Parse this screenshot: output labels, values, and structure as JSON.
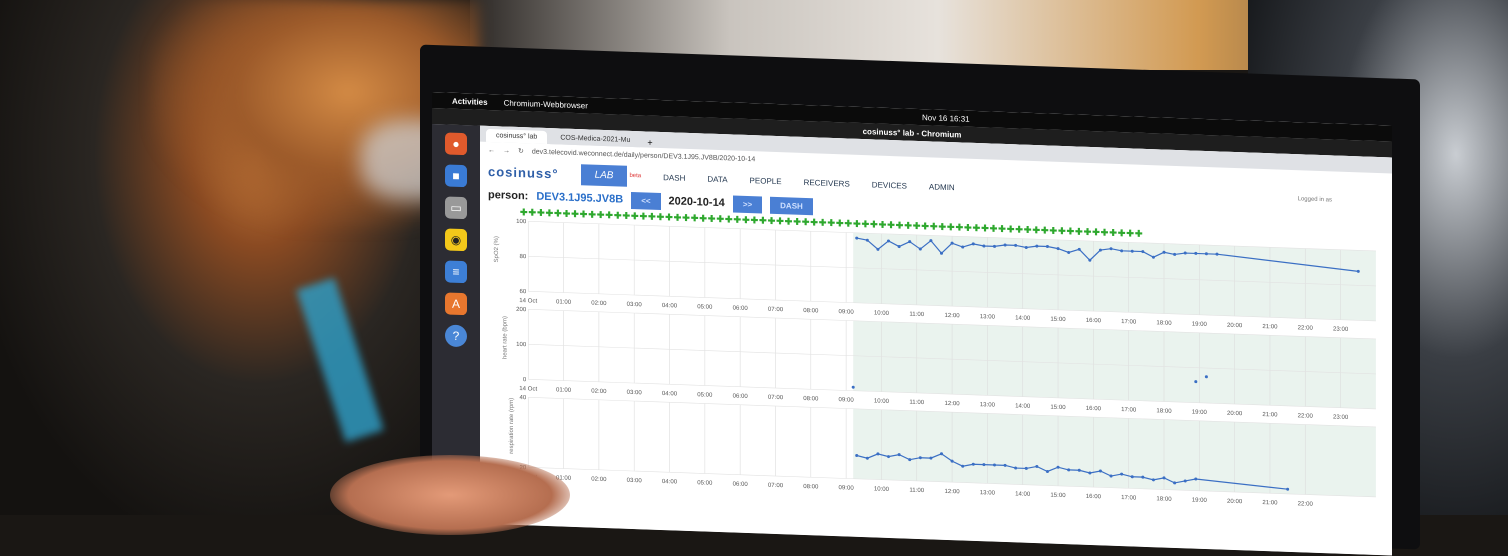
{
  "desktop": {
    "activities": "Activities",
    "app_menu": "Chromium-Webbrowser",
    "clock": "Nov 16 16:31",
    "window_title": "cosinuss° lab - Chromium"
  },
  "browser": {
    "tabs": [
      {
        "label": "cosinuss° lab"
      },
      {
        "label": "COS-Medica-2021-Mu"
      }
    ],
    "url": "dev3.telecovid.weconnect.de/daily/person/DEV3.1J95.JV8B/2020-10-14"
  },
  "app": {
    "logo": "cosinuss°",
    "lab": "LAB",
    "beta": "beta",
    "nav": [
      "DASH",
      "DATA",
      "PEOPLE",
      "RECEIVERS",
      "DEVICES",
      "ADMIN"
    ],
    "logged_in": "Logged in as",
    "person_label": "person:",
    "person_id": "DEV3.1J95.JV8B",
    "prev_button": "<<",
    "date": "2020-10-14",
    "next_button": ">>",
    "dash_button": "DASH"
  },
  "colors": {
    "accent": "#4a7fd4",
    "marker": "#2ea82e",
    "line": "#3b6fc4"
  },
  "chart_data": [
    {
      "type": "line",
      "ylabel": "SpO2 (%)",
      "yticks": [
        "100",
        "80",
        "60"
      ],
      "xticks": [
        "14 Oct",
        "01:00",
        "02:00",
        "03:00",
        "04:00",
        "05:00",
        "06:00",
        "07:00",
        "08:00",
        "09:00",
        "10:00",
        "11:00",
        "12:00",
        "13:00",
        "14:00",
        "15:00",
        "16:00",
        "17:00",
        "18:00",
        "19:00",
        "20:00",
        "21:00",
        "22:00",
        "23:00"
      ],
      "ylim": [
        60,
        100
      ],
      "x": [
        9.3,
        9.6,
        9.9,
        10.2,
        10.5,
        10.8,
        11.1,
        11.4,
        11.7,
        12.0,
        12.3,
        12.6,
        12.9,
        13.2,
        13.5,
        13.8,
        14.1,
        14.4,
        14.7,
        15.0,
        15.3,
        15.6,
        15.9,
        16.2,
        16.5,
        16.8,
        17.1,
        17.4,
        17.7,
        18.0,
        18.3,
        18.6,
        18.9,
        19.2,
        19.5,
        23.5
      ],
      "y": [
        97,
        96,
        91,
        96,
        93,
        96,
        92,
        97,
        90,
        96,
        94,
        96,
        95,
        95,
        96,
        96,
        95,
        96,
        96,
        95,
        93,
        95,
        89,
        95,
        96,
        95,
        95,
        95,
        92,
        95,
        94,
        95,
        95,
        95,
        95,
        88
      ]
    },
    {
      "type": "scatter",
      "ylabel": "heart rate (bpm)",
      "yticks": [
        "200",
        "100",
        "0"
      ],
      "xticks": [
        "14 Oct",
        "01:00",
        "02:00",
        "03:00",
        "04:00",
        "05:00",
        "06:00",
        "07:00",
        "08:00",
        "09:00",
        "10:00",
        "11:00",
        "12:00",
        "13:00",
        "14:00",
        "15:00",
        "16:00",
        "17:00",
        "18:00",
        "19:00",
        "20:00",
        "21:00",
        "22:00",
        "23:00"
      ],
      "ylim": [
        0,
        200
      ],
      "x": [
        9.2,
        18.9,
        19.2
      ],
      "y": [
        10,
        60,
        75
      ]
    },
    {
      "type": "line",
      "ylabel": "respiration rate (rpm)",
      "yticks": [
        "40",
        "20"
      ],
      "xticks": [
        "14 Oct",
        "01:00",
        "02:00",
        "03:00",
        "04:00",
        "05:00",
        "06:00",
        "07:00",
        "08:00",
        "09:00",
        "10:00",
        "11:00",
        "12:00",
        "13:00",
        "14:00",
        "15:00",
        "16:00",
        "17:00",
        "18:00",
        "19:00",
        "20:00",
        "21:00",
        "22:00"
      ],
      "ylim": [
        10,
        40
      ],
      "x": [
        9.3,
        9.6,
        9.9,
        10.2,
        10.5,
        10.8,
        11.1,
        11.4,
        11.7,
        12.0,
        12.3,
        12.6,
        12.9,
        13.2,
        13.5,
        13.8,
        14.1,
        14.4,
        14.7,
        15.0,
        15.3,
        15.6,
        15.9,
        16.2,
        16.5,
        16.8,
        17.1,
        17.4,
        17.7,
        18.0,
        18.3,
        18.6,
        18.9,
        21.5
      ],
      "y": [
        20,
        19,
        21,
        20,
        21,
        19,
        20,
        20,
        22,
        19,
        17,
        18,
        18,
        18,
        18,
        17,
        17,
        18,
        16,
        18,
        17,
        17,
        16,
        17,
        15,
        16,
        15,
        15,
        14,
        15,
        13,
        14,
        15,
        12
      ]
    }
  ]
}
